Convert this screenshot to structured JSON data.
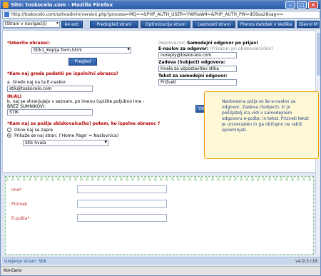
{
  "window": {
    "title": "Site: toskocelo.com - Mozilla Firefox",
    "url": "http://toskocelo.com/sohoadmin/version.php?process=MQ==&PHP_AUTH_USER=YWRtaW4=&PHP_AUTH_PW=dG9za28xag=="
  },
  "toolbar": {
    "nav_select": "[Strani v navigaciji]",
    "btn_ext": "èe ext.",
    "btn_preview": "Predogled strani",
    "btn_optimize": "Optimizacija strani",
    "btn_properties": "Lastnosti strani",
    "btn_download": "Prenos datotek v Vedika",
    "btn_main": "Glavni M"
  },
  "form": {
    "select_form_label": "*Izberite obrazec:",
    "select_form_value": "Stik1_Kopija form.html",
    "preview_button": "Pregled",
    "send_data_label": "*Kam naj gredo podatki po izpolnitvi obrazca?",
    "email_option_label": "a. Gredo naj na ta E-naslov:",
    "email_value": "stik@toskocelo.com",
    "or_label": "IN/ALI",
    "db_option_label": "b. naj se shranjujejo v seznam, po imenu (vpišite poljubno ime - BREZ ŠUMNIKOV):",
    "db_value": "STIK",
    "redirect_label": "*Kam naj se pošlje obiskovalca(ko) potem, ko izpolne obrazec ?",
    "radio_new_window": "Okno naj se zapre",
    "radio_page": "Prikaže se naj stran: ('Home Page' = Naslovnica)",
    "page_select_value": "Stik hvala",
    "insert_button": "Vstavite obrazec"
  },
  "autoreply": {
    "heading_optional": "(Neobvezno)",
    "heading": "Samodejni odgovor po prijavi",
    "from_label": "E-naslov za odgovor:",
    "from_hint": "(Prikazan pri obiskovalcu(ko))",
    "from_value": "noreply@toskocelo.com",
    "subject_label": "Zadeva (Subject) odgovora:",
    "subject_value": "Hvala za vzpostavitev stika",
    "text_label": "Tekst za samodejni odgovor:",
    "text_value": "Prižveti"
  },
  "tooltip": {
    "text": "Neobvezna polja so še e-naslov za odgovor, Zadeva (Subject), ki jo pošiljatelj-ica vidi v samodejnem odgovoru e-pošte, in tekst. Prizveti tekst je univerzalen in ga običajno ne rabiš spreminjati."
  },
  "preview_form": {
    "field_name": "Ime*",
    "field_surname": "Priimek",
    "field_email": "E-pošta*"
  },
  "editbar": {
    "label": "Urejanje strani: Stik",
    "version": "v4.9.3 r18"
  },
  "status": {
    "text": "Končano"
  }
}
